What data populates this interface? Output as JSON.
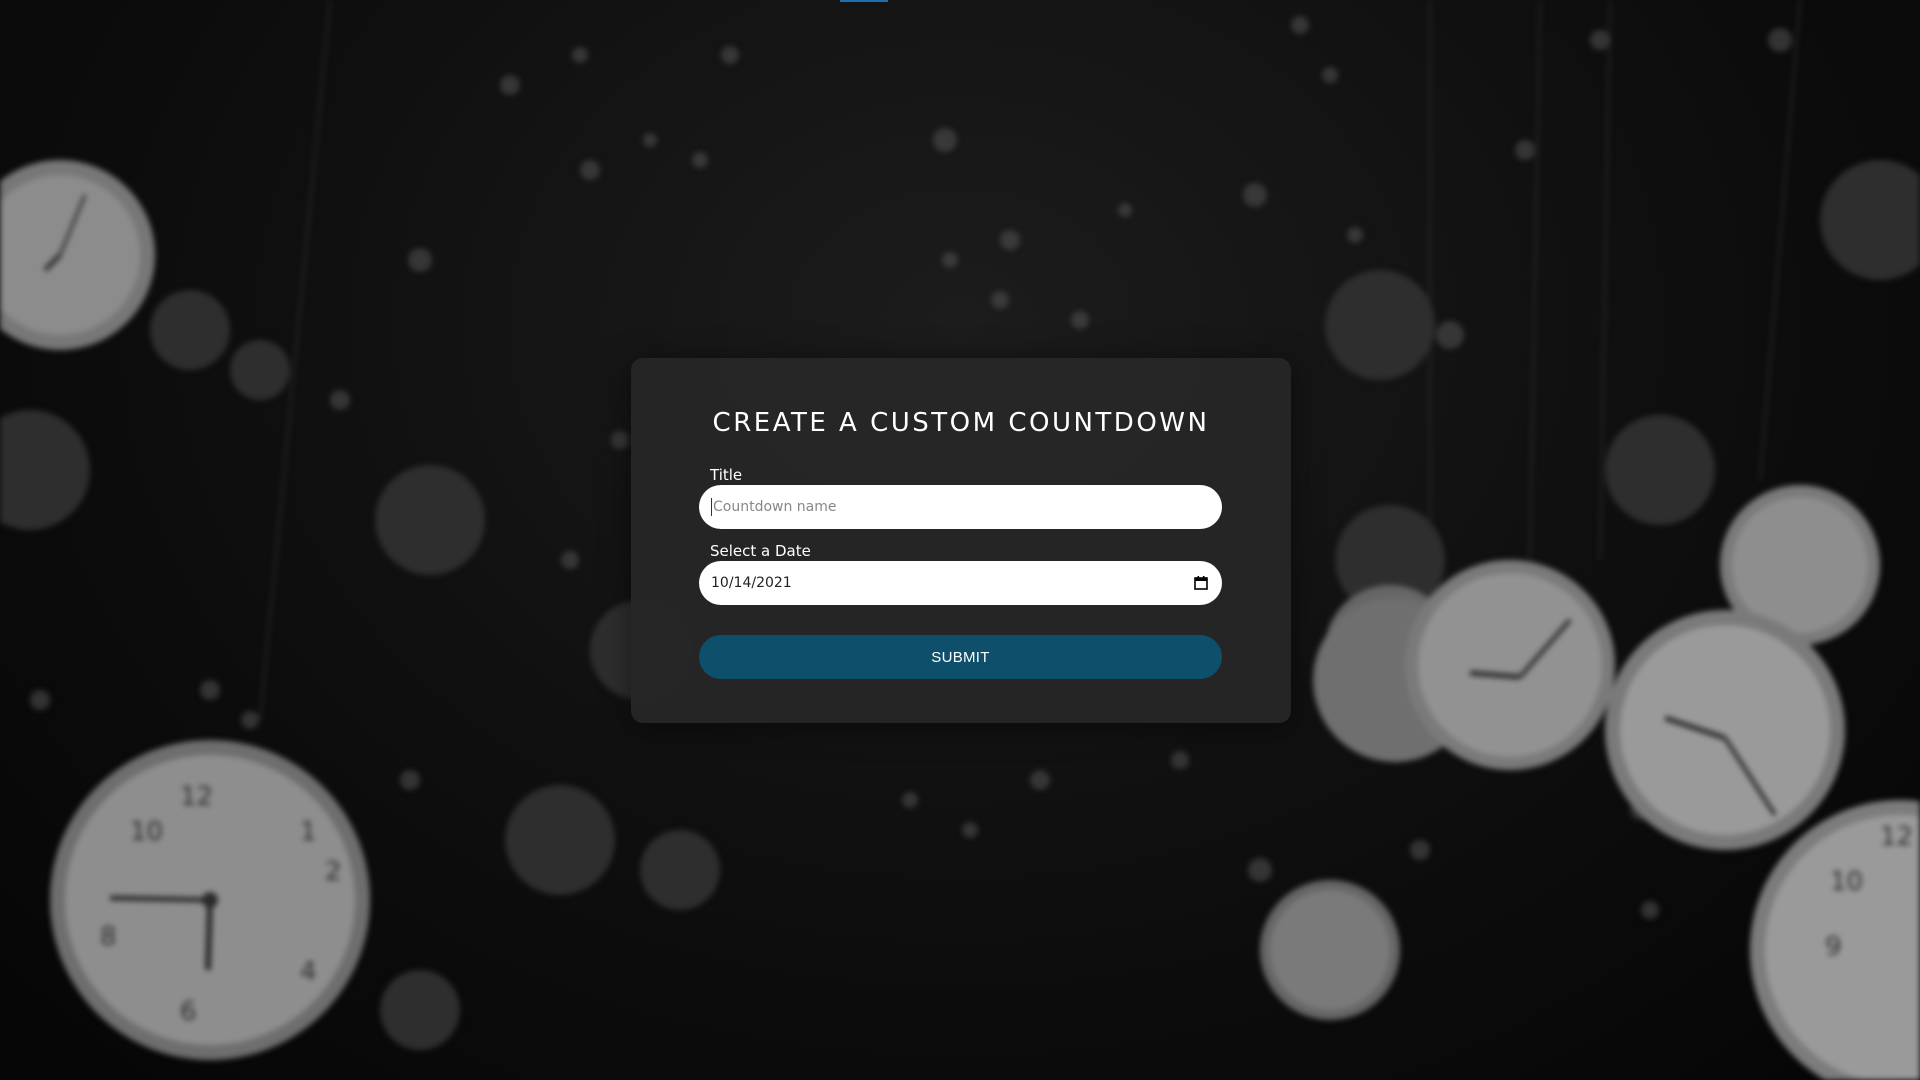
{
  "form": {
    "heading": "CREATE A CUSTOM COUNTDOWN",
    "title_label": "Title",
    "title_value": "",
    "title_placeholder": "Countdown name",
    "date_label": "Select a Date",
    "date_value": "10/14/2021",
    "submit_label": "SUBMIT"
  },
  "icons": {
    "date_picker": "calendar-icon"
  },
  "colors": {
    "submit_button": "#0e4f6b",
    "card_background": "#262626",
    "accent_indicator": "#1e6fb0"
  }
}
